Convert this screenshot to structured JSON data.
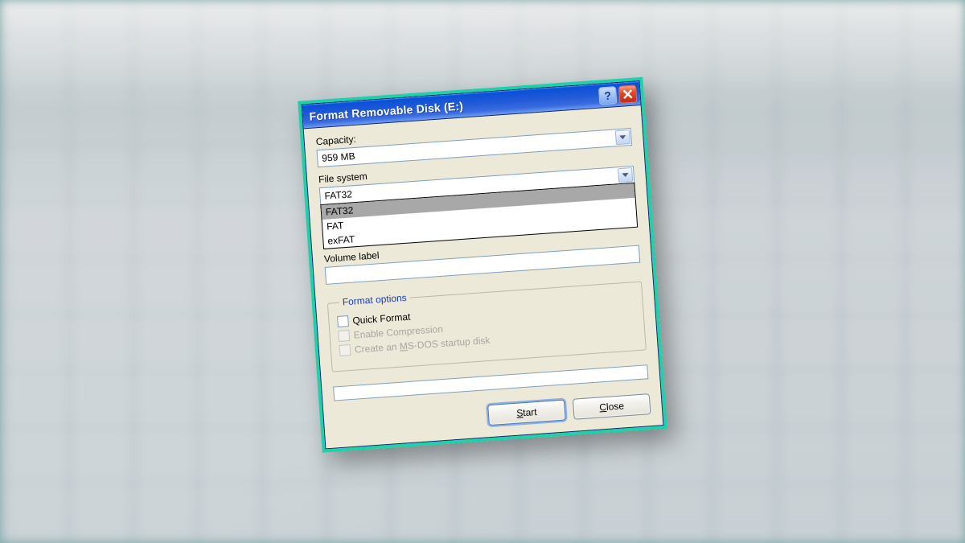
{
  "window": {
    "title": "Format Removable Disk (E:)"
  },
  "labels": {
    "capacity": "Capacity:",
    "filesystem": "File system",
    "volume": "Volume label",
    "options_legend": "Format options",
    "quick_format": "Quick Format",
    "enable_compression": "Enable Compression",
    "msdos_prefix": "Create an ",
    "msdos_u": "M",
    "msdos_suffix": "S-DOS startup disk"
  },
  "fields": {
    "capacity_value": "959 MB",
    "filesystem_value": "FAT32",
    "filesystem_options": [
      "FAT32",
      "FAT",
      "exFAT"
    ],
    "volume_value": ""
  },
  "buttons": {
    "start_u": "S",
    "start_rest": "tart",
    "close_u": "C",
    "close_rest": "lose"
  }
}
